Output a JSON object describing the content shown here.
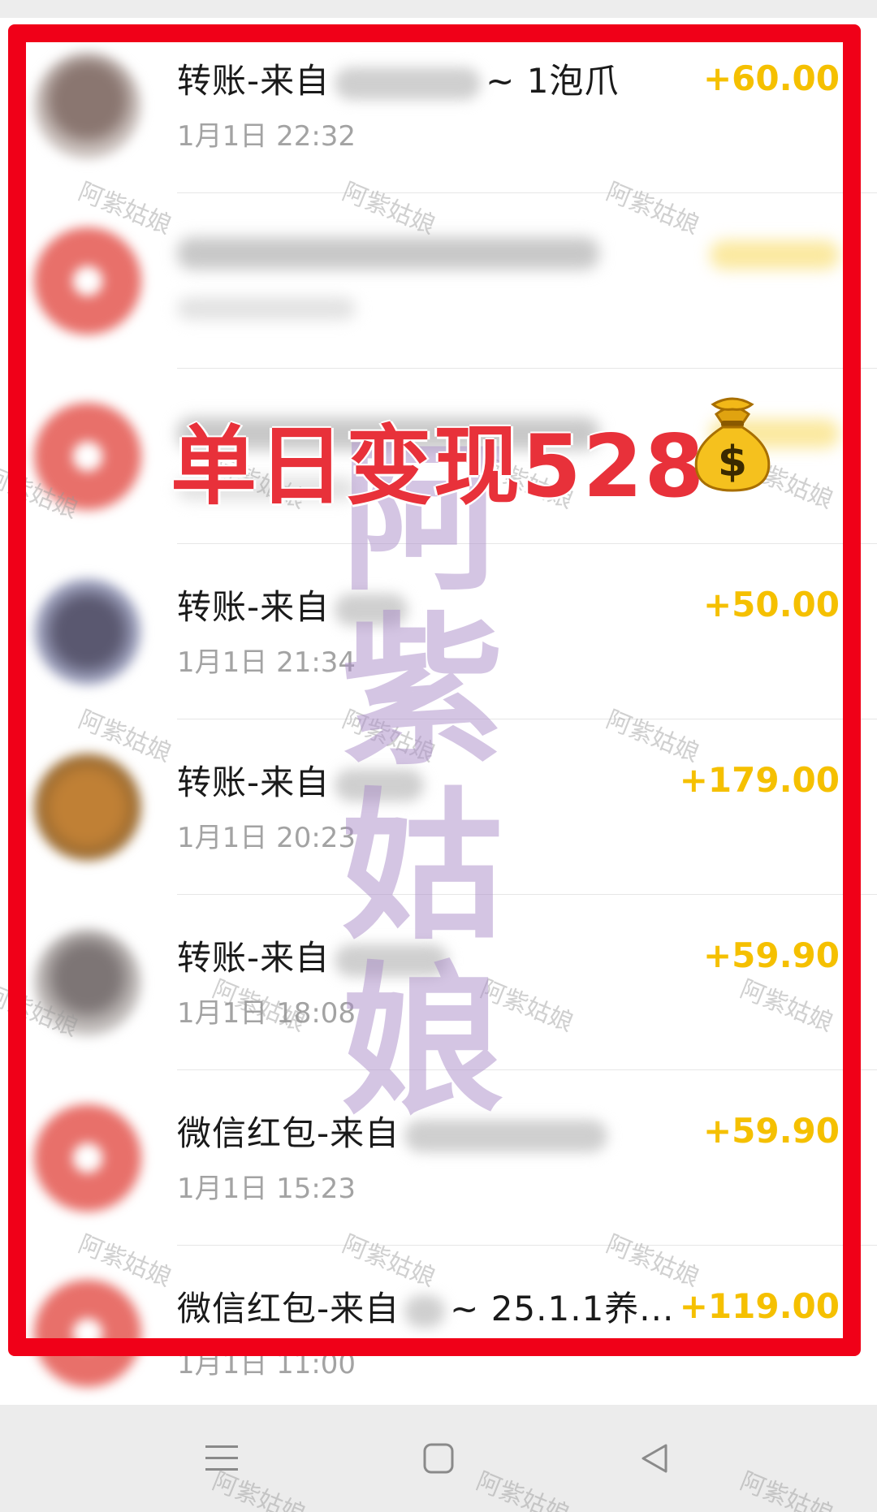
{
  "overlay": {
    "headline": "单日变现528",
    "money_icon": "money-bag-icon",
    "watermark_vertical": [
      "阿",
      "紫",
      "姑",
      "娘"
    ],
    "watermark_small": "阿紫姑娘",
    "frame_color": "#f00018",
    "headline_color": "#e8313a"
  },
  "accent_color": "#f5c000",
  "transactions": [
    {
      "title_prefix": "转账-来自",
      "title_suffix": "~ 1泡爪",
      "time": "1月1日 22:32",
      "amount": "+60.00",
      "avatar": "photo-a"
    },
    {
      "title_prefix": "",
      "title_suffix": "",
      "time": "",
      "amount": "",
      "avatar": "red",
      "blurred": true
    },
    {
      "title_prefix": "",
      "title_suffix": "",
      "time": "",
      "amount": "",
      "avatar": "red",
      "blurred": true
    },
    {
      "title_prefix": "转账-来自",
      "title_suffix": "",
      "time": "1月1日 21:34",
      "amount": "+50.00",
      "avatar": "photo-b"
    },
    {
      "title_prefix": "转账-来自",
      "title_suffix": "",
      "time": "1月1日 20:23",
      "amount": "+179.00",
      "avatar": "photo-c"
    },
    {
      "title_prefix": "转账-来自",
      "title_suffix": "",
      "time": "1月1日 18:08",
      "amount": "+59.90",
      "avatar": "photo-d"
    },
    {
      "title_prefix": "微信红包-来自",
      "title_suffix": "",
      "time": "1月1日 15:23",
      "amount": "+59.90",
      "avatar": "red"
    },
    {
      "title_prefix": "微信红包-来自",
      "title_suffix": "~ 25.1.1养...",
      "time": "1月1日 11:00",
      "amount": "+119.00",
      "avatar": "red"
    }
  ],
  "navbar": {
    "menu_icon": "menu-icon",
    "home_icon": "home-square-icon",
    "back_icon": "back-triangle-icon"
  }
}
